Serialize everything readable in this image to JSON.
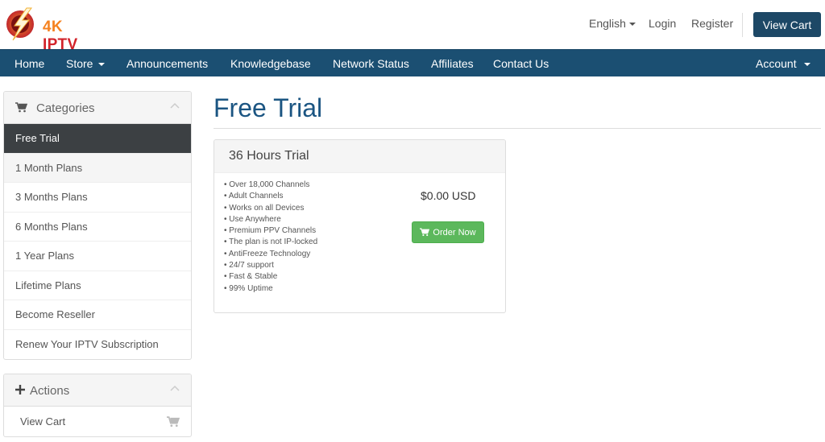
{
  "brand": {
    "four_k": "4K",
    "iptv": "IPTV"
  },
  "top_nav": {
    "language": "English",
    "login": "Login",
    "register": "Register",
    "view_cart": "View Cart"
  },
  "main_nav": {
    "items": [
      {
        "label": "Home"
      },
      {
        "label": "Store"
      },
      {
        "label": "Announcements"
      },
      {
        "label": "Knowledgebase"
      },
      {
        "label": "Network Status"
      },
      {
        "label": "Affiliates"
      },
      {
        "label": "Contact Us"
      }
    ],
    "account": "Account"
  },
  "sidebar": {
    "categories_title": "Categories",
    "categories": [
      {
        "label": "Free Trial",
        "active": true
      },
      {
        "label": "1 Month Plans"
      },
      {
        "label": "3 Months Plans"
      },
      {
        "label": "6 Months Plans"
      },
      {
        "label": "1 Year Plans"
      },
      {
        "label": "Lifetime Plans"
      },
      {
        "label": "Become Reseller"
      },
      {
        "label": "Renew Your IPTV Subscription"
      }
    ],
    "actions_title": "Actions",
    "actions": [
      {
        "label": "View Cart",
        "icon": "cart-icon"
      }
    ]
  },
  "page": {
    "title": "Free Trial",
    "product": {
      "name": "36 Hours Trial",
      "features": [
        "• Over 18,000 Channels",
        "• Adult Channels",
        "• Works on all Devices",
        "• Use Anywhere",
        "• Premium PPV Channels",
        "• The plan is not IP-locked",
        "• AntiFreeze Technology",
        "• 24/7 support",
        "• Fast & Stable",
        "• 99% Uptime"
      ],
      "price": "$0.00 USD",
      "order_label": "Order Now"
    }
  },
  "colors": {
    "navbar": "#1b4f72",
    "cart_button": "#1d4866",
    "title": "#1b5582",
    "order_button": "#5cb85c",
    "active_category": "#3c4043"
  }
}
